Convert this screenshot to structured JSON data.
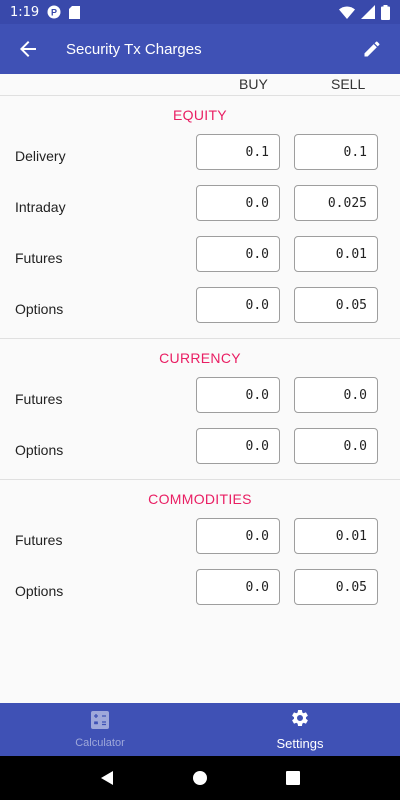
{
  "status_bar": {
    "time": "1:19"
  },
  "app_bar": {
    "title": "Security Tx Charges"
  },
  "columns": {
    "buy": "BUY",
    "sell": "SELL"
  },
  "sections": [
    {
      "title": "EQUITY",
      "rows": [
        {
          "label": "Delivery",
          "buy": "0.1",
          "sell": "0.1"
        },
        {
          "label": "Intraday",
          "buy": "0.0",
          "sell": "0.025"
        },
        {
          "label": "Futures",
          "buy": "0.0",
          "sell": "0.01"
        },
        {
          "label": "Options",
          "buy": "0.0",
          "sell": "0.05"
        }
      ]
    },
    {
      "title": "CURRENCY",
      "rows": [
        {
          "label": "Futures",
          "buy": "0.0",
          "sell": "0.0"
        },
        {
          "label": "Options",
          "buy": "0.0",
          "sell": "0.0"
        }
      ]
    },
    {
      "title": "COMMODITIES",
      "rows": [
        {
          "label": "Futures",
          "buy": "0.0",
          "sell": "0.01"
        },
        {
          "label": "Options",
          "buy": "0.0",
          "sell": "0.05"
        }
      ]
    }
  ],
  "bottom_nav": [
    {
      "label": "Calculator",
      "icon": "calculator-icon",
      "active": false
    },
    {
      "label": "Settings",
      "icon": "gear-icon",
      "active": true
    }
  ],
  "colors": {
    "primary": "#3f51b5",
    "status_bar": "#3949ab",
    "section_title": "#e91e63"
  }
}
